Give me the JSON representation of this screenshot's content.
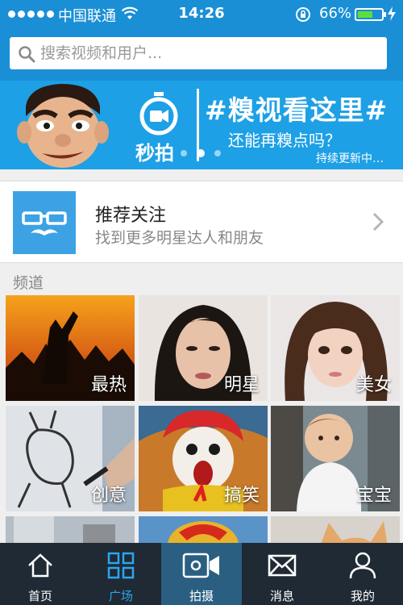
{
  "status_bar": {
    "carrier": "中国联通",
    "time": "14:26",
    "battery_percent": "66%",
    "battery_level": 0.66,
    "icons": [
      "signal-dots-icon",
      "wifi-icon",
      "rotation-lock-icon",
      "battery-icon",
      "charging-bolt-icon"
    ]
  },
  "search": {
    "placeholder": "搜索视频和用户..."
  },
  "banner": {
    "brand": "秒拍",
    "headline": "#糗视看这里#",
    "subline": "还能再糗点吗？",
    "tagline": "持续更新中…",
    "page_count": 3,
    "active_page": 2
  },
  "recommend": {
    "title": "推荐关注",
    "subtitle": "找到更多明星达人和朋友"
  },
  "channels": {
    "label": "频道",
    "items": [
      {
        "label": "最热"
      },
      {
        "label": "明星"
      },
      {
        "label": "美女"
      },
      {
        "label": "创意"
      },
      {
        "label": "搞笑"
      },
      {
        "label": "宝宝"
      }
    ]
  },
  "tabbar": {
    "items": [
      {
        "label": "首页",
        "icon": "home-icon"
      },
      {
        "label": "广场",
        "icon": "grid-icon",
        "active": true
      },
      {
        "label": "拍摄",
        "icon": "video-camera-icon"
      },
      {
        "label": "消息",
        "icon": "mail-icon"
      },
      {
        "label": "我的",
        "icon": "person-icon"
      }
    ]
  },
  "colors": {
    "header_blue": "#1a8fd6",
    "banner_blue": "#1da0e6",
    "active_tab": "#2ba6ef",
    "tabbar_bg": "#1f2a34"
  }
}
